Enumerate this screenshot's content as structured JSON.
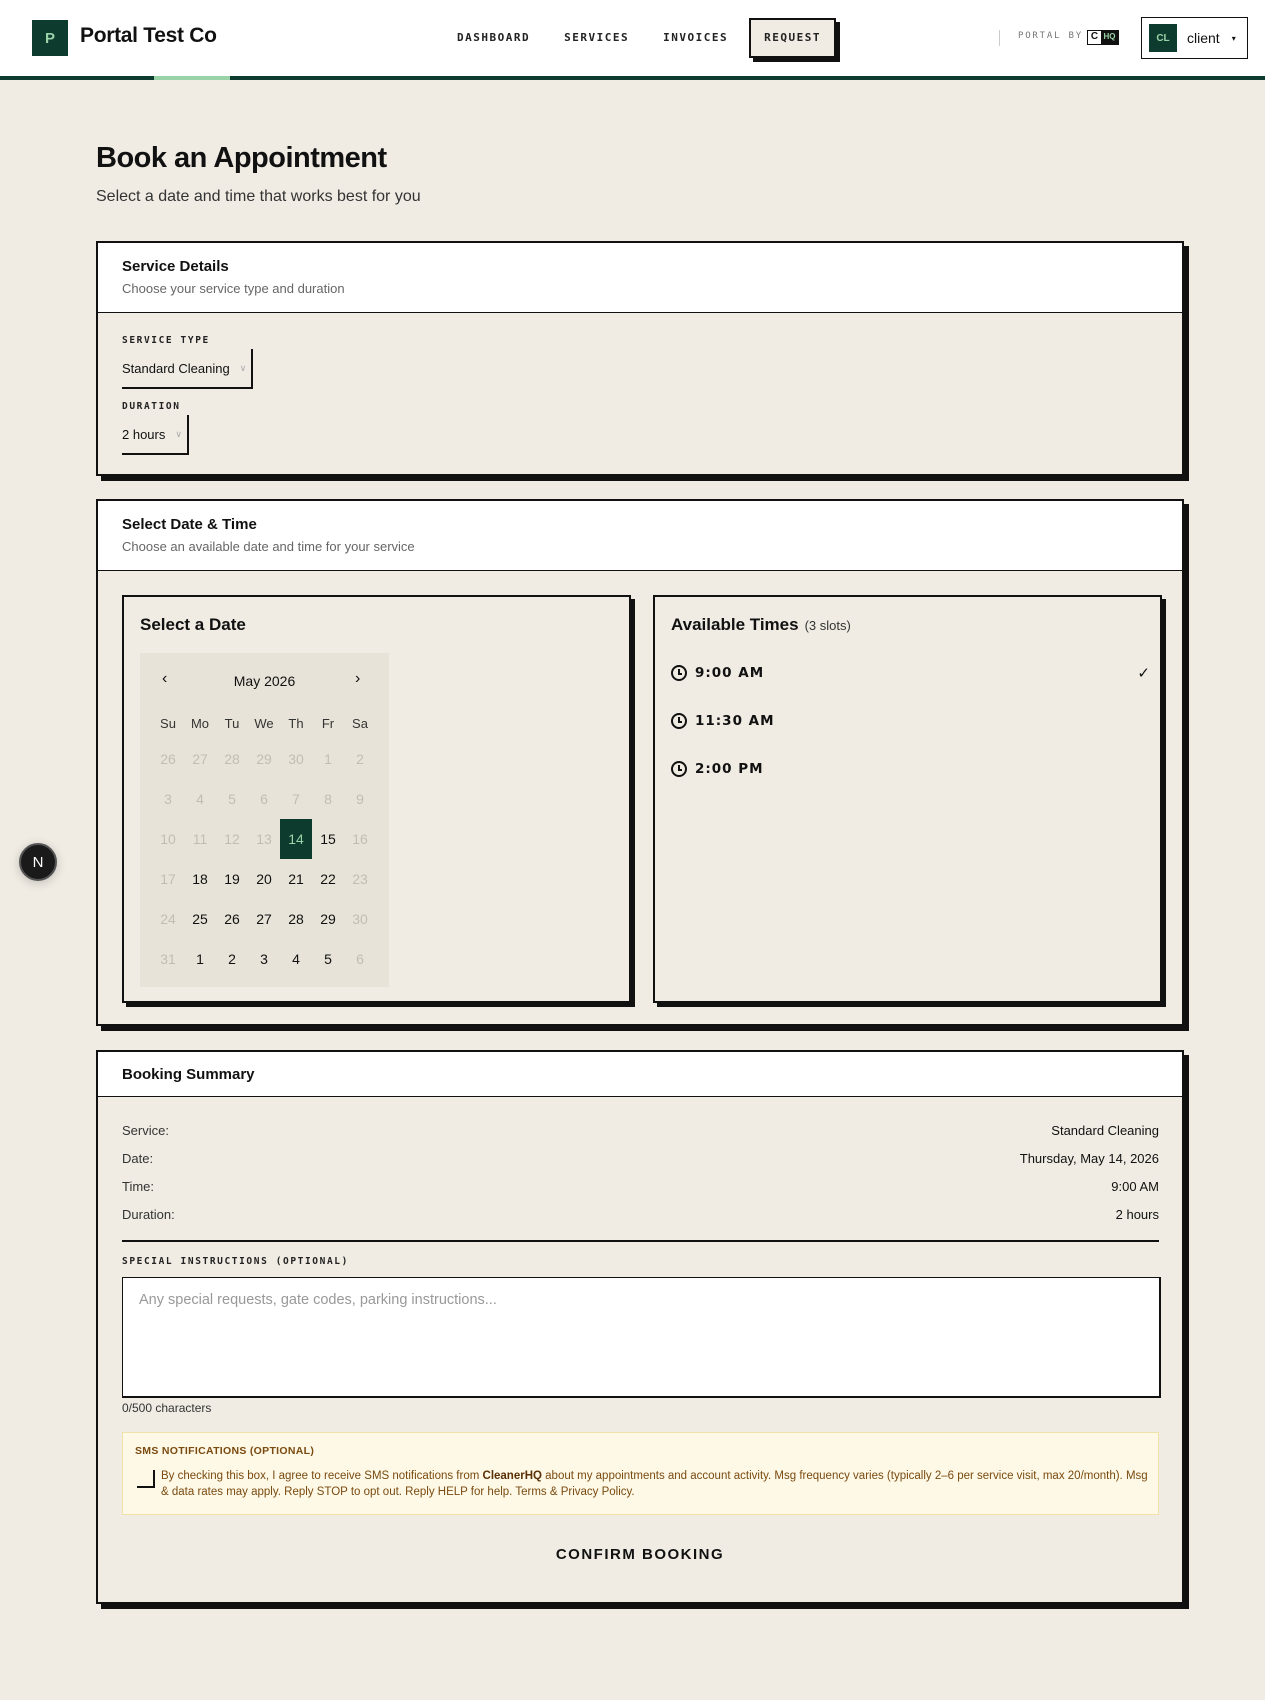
{
  "header": {
    "logo_letter": "P",
    "brand": "Portal Test Co",
    "nav": [
      "DASHBOARD",
      "SERVICES",
      "INVOICES",
      "REQUEST"
    ],
    "portal_by": "PORTAL BY",
    "hq_c": "C",
    "hq_hq": "HQ",
    "user_initials": "CL",
    "user_name": "client",
    "user_caret": "▾"
  },
  "page": {
    "title": "Book an Appointment",
    "subtitle": "Select a date and time that works best for you"
  },
  "service_details": {
    "title": "Service Details",
    "subtitle": "Choose your service type and duration",
    "service_type_label": "SERVICE TYPE",
    "service_type_value": "Standard Cleaning",
    "duration_label": "DURATION",
    "duration_value": "2 hours"
  },
  "date_time": {
    "title": "Select Date & Time",
    "subtitle": "Choose an available date and time for your service",
    "calendar_title": "Select a Date",
    "month": "May 2026",
    "prev": "‹",
    "next": "›",
    "weekdays": [
      "Su",
      "Mo",
      "Tu",
      "We",
      "Th",
      "Fr",
      "Sa"
    ],
    "weeks": [
      [
        "26",
        "27",
        "28",
        "29",
        "30",
        "1",
        "2"
      ],
      [
        "3",
        "4",
        "5",
        "6",
        "7",
        "8",
        "9"
      ],
      [
        "10",
        "11",
        "12",
        "13",
        "14",
        "15",
        "16"
      ],
      [
        "17",
        "18",
        "19",
        "20",
        "21",
        "22",
        "23"
      ],
      [
        "24",
        "25",
        "26",
        "27",
        "28",
        "29",
        "30"
      ],
      [
        "31",
        "1",
        "2",
        "3",
        "4",
        "5",
        "6"
      ]
    ],
    "times_title": "Available Times",
    "slots_count": "(3 slots)",
    "times": [
      "9:00 AM",
      "11:30 AM",
      "2:00 PM"
    ],
    "selected_check": "✓"
  },
  "summary": {
    "title": "Booking Summary",
    "rows": [
      {
        "k": "Service:",
        "v": "Standard Cleaning"
      },
      {
        "k": "Date:",
        "v": "Thursday, May 14, 2026"
      },
      {
        "k": "Time:",
        "v": "9:00 AM"
      },
      {
        "k": "Duration:",
        "v": "2 hours"
      }
    ],
    "instructions_label": "SPECIAL INSTRUCTIONS (OPTIONAL)",
    "instructions_placeholder": "Any special requests, gate codes, parking instructions...",
    "char_count": "0/500 characters",
    "sms_title": "SMS NOTIFICATIONS (OPTIONAL)",
    "sms_text_1": "By checking this box, I agree to receive SMS notifications from ",
    "sms_brand": "CleanerHQ",
    "sms_text_2": " about my appointments and account activity. Msg frequency varies (typically 2–6 per service visit, max 20/month). Msg & data rates may apply. Reply STOP to opt out. Reply HELP for help. Terms & Privacy Policy.",
    "confirm": "CONFIRM BOOKING"
  },
  "floating": {
    "label": "N"
  },
  "colors": {
    "brand_green": "#0d3b2e",
    "accent_mint": "#9ad3a8",
    "background": "#f0ece4"
  }
}
